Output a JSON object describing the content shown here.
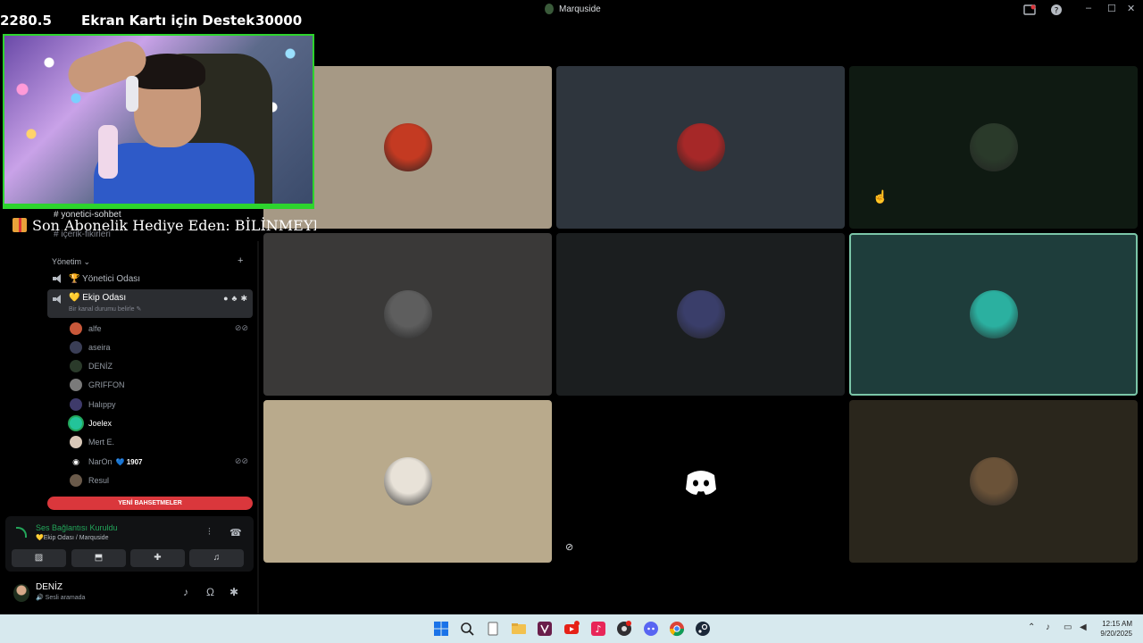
{
  "window": {
    "title": "Marquside",
    "controls": {
      "minimize": "–",
      "maximize": "☐",
      "close": "✕"
    }
  },
  "stream_overlay": {
    "left_value": "2280.5",
    "goal_title": "Ekran Kartı için Destek",
    "goal_target": "30000",
    "gift_line": "Son Abonelik Hediye Eden: BİLİNMEYE"
  },
  "channels_above": {
    "first": "yonetici-sohbet",
    "second": "içerik-fikirleri"
  },
  "sidebar": {
    "category": "Yönetim",
    "category_chevron": "⌄",
    "add": "+",
    "channels": [
      {
        "label": "🏆 Yönetici Odası"
      },
      {
        "label": "💛 Ekip Odası",
        "status_prompt": "Bir kanal durumu belirle ✎"
      }
    ],
    "members": [
      {
        "name": "alfe",
        "muted": true
      },
      {
        "name": "aseira"
      },
      {
        "name": "DENİZ"
      },
      {
        "name": "GRIFFON"
      },
      {
        "name": "Halıppy"
      },
      {
        "name": "Joelex",
        "bold": true
      },
      {
        "name": "Mert E."
      },
      {
        "name": "NarOn",
        "badge": "💙 1907",
        "muted": true
      },
      {
        "name": "Resul"
      }
    ],
    "mentions_button": "YENİ BAHSETMELER"
  },
  "voice_panel": {
    "status": "Ses Bağlantısı Kuruldu",
    "location": "💛Ekip Odası / Marquside",
    "buttons": [
      "camera-off",
      "screen-share",
      "activity",
      "soundboard"
    ]
  },
  "user_panel": {
    "name": "DENİZ",
    "status": "🔊 Sesli aramada"
  },
  "tiles": [
    {
      "name": "tile-user-1",
      "bg": "#a69985",
      "avatar_color": "#c43a22"
    },
    {
      "name": "tile-user-2",
      "bg": "#2e353d",
      "avatar_color": "#a62828"
    },
    {
      "name": "tile-user-3",
      "bg": "#0f1a12",
      "avatar_color": "#2a3a2a"
    },
    {
      "name": "tile-user-4",
      "bg": "#3a3938",
      "avatar_color": "#5e5e5e"
    },
    {
      "name": "tile-user-5",
      "bg": "#1b1e1f",
      "avatar_color": "#3a3e6a"
    },
    {
      "name": "tile-user-6",
      "bg": "#1e3d3b",
      "avatar_color": "#2bb0a0",
      "speaking": true
    },
    {
      "name": "tile-user-7",
      "bg": "#b9aa8c",
      "avatar_color": "#e8e2d8"
    },
    {
      "name": "tile-user-8",
      "bg": "#000000",
      "avatar_color": "#000000",
      "discord": true
    },
    {
      "name": "tile-user-9",
      "bg": "#2a261c",
      "avatar_color": "#6a5238"
    }
  ],
  "taskbar": {
    "time": "12:15 AM",
    "date": "9/20/2025"
  },
  "colors": {
    "accent_green": "#23a55a",
    "mention_red": "#da373c",
    "speaking_outline": "#7bc6a8",
    "webcam_border": "#2dd42d"
  }
}
